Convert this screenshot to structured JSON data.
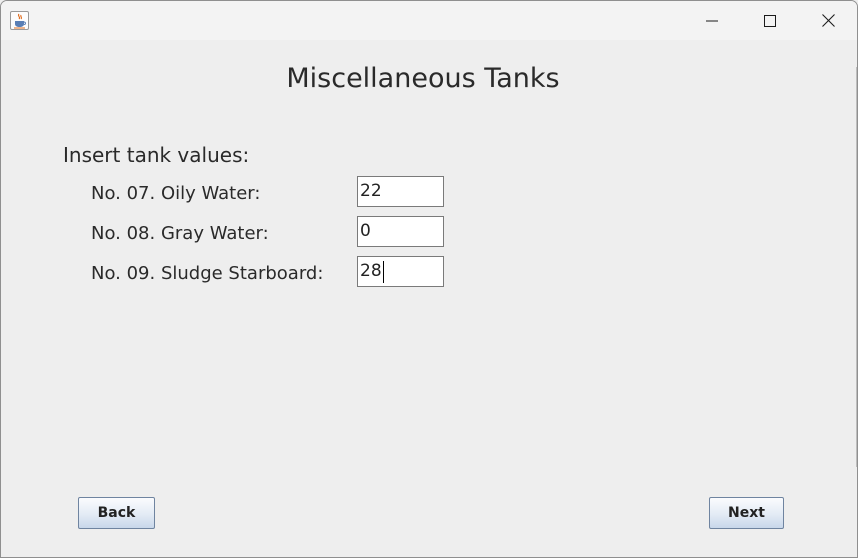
{
  "window": {
    "app_icon": "java-coffee-cup-icon",
    "controls": [
      "minimize-icon",
      "maximize-icon",
      "close-icon"
    ]
  },
  "page": {
    "title": "Miscellaneous Tanks",
    "section_label": "Insert tank values:"
  },
  "tanks": [
    {
      "label": "No. 07. Oily Water:",
      "value": "22"
    },
    {
      "label": "No. 08. Gray Water:",
      "value": "0"
    },
    {
      "label": "No. 09. Sludge Starboard:",
      "value": "28"
    }
  ],
  "buttons": {
    "back": "Back",
    "next": "Next"
  }
}
